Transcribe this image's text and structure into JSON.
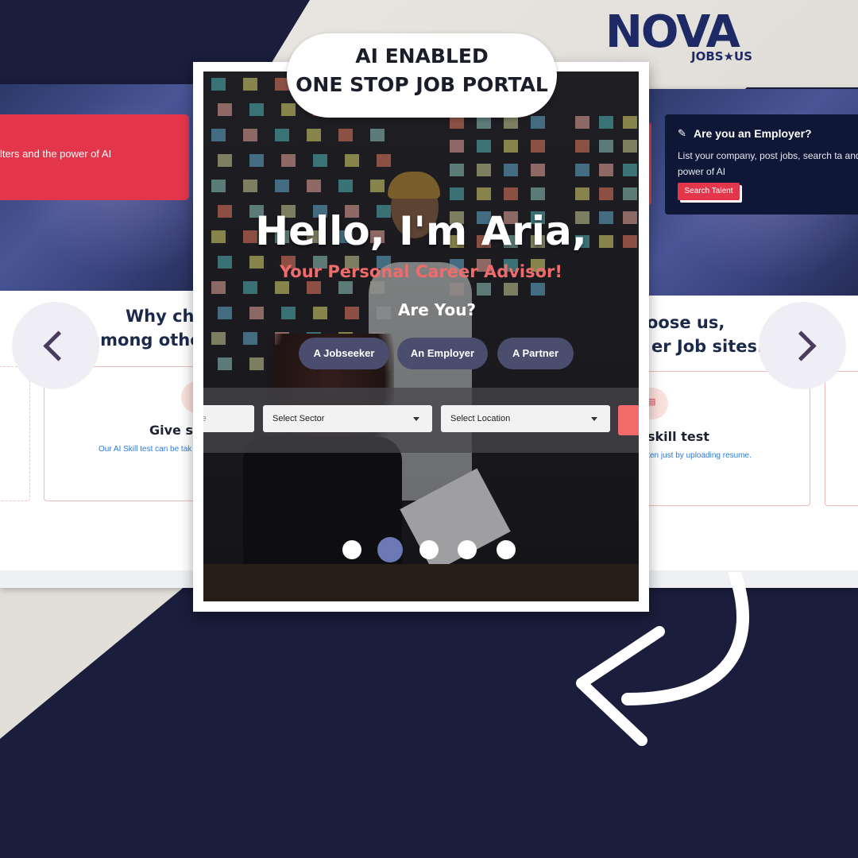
{
  "badge": {
    "line1": "AI ENABLED",
    "line2": "ONE STOP JOB PORTAL"
  },
  "logo": {
    "brand": "NOVA",
    "tagline": "JOBS★US"
  },
  "hero": {
    "greeting": "Hello, I'm Aria,",
    "subtitle": "Your Personal Career Advisor!",
    "question": "Are You?",
    "options": [
      "A Jobseeker",
      "An Employer",
      "A Partner"
    ],
    "search": {
      "keyword_fragment": "se",
      "sector": "Select Sector",
      "location": "Select Location"
    },
    "carousel": {
      "slides": 5,
      "active_index": 1
    }
  },
  "left_preview": {
    "banner_text": "lters and the power of AI",
    "heading_line1": "Why ch",
    "heading_line2": "among othe",
    "card_title": "Give s",
    "card_desc": "Our AI Skill test can be tak"
  },
  "right_preview": {
    "employer_title": "Are you an Employer?",
    "employer_desc": "List your company, post jobs, search ta and power of AI",
    "search_talent": "Search Talent",
    "heading_line1": "oose us,",
    "heading_line2": "er Job sites.",
    "card_title": "skill test",
    "card_desc": "ken just by uploading resume."
  },
  "colors": {
    "navy": "#1a1d3b",
    "accent_red": "#e3364a",
    "advisor_pink": "#f06b6b",
    "pill": "#4b4d6e",
    "dot_active": "#6c79b5",
    "logo_blue": "#1e2a66"
  },
  "icons": [
    "chevron-left-icon",
    "chevron-right-icon",
    "edit-icon",
    "document-icon",
    "curved-arrow-icon"
  ]
}
